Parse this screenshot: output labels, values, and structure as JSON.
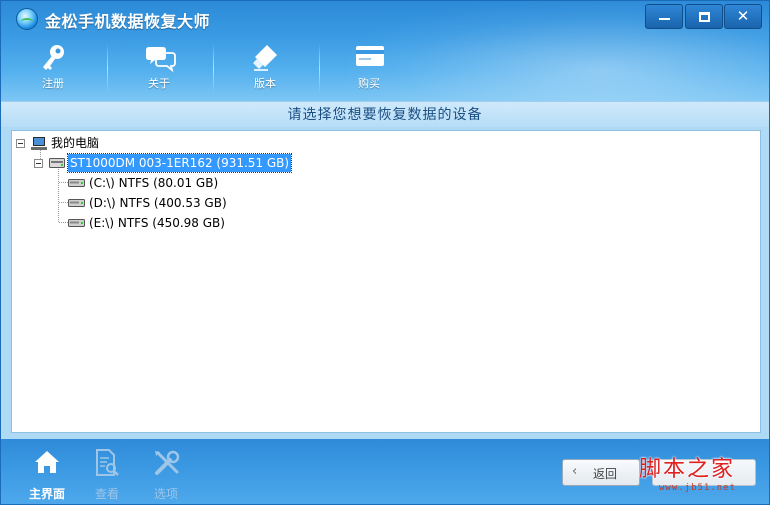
{
  "window": {
    "title": "金松手机数据恢复大师",
    "controls": {
      "minimize": "",
      "maximize": "",
      "close": "✕"
    }
  },
  "toolbar": {
    "items": [
      {
        "label": "注册",
        "icon": "key-icon"
      },
      {
        "label": "关于",
        "icon": "chat-bubbles-icon"
      },
      {
        "label": "版本",
        "icon": "usb-drive-icon"
      },
      {
        "label": "购买",
        "icon": "credit-card-icon"
      }
    ]
  },
  "heading": "请选择您想要恢复数据的设备",
  "tree": {
    "root": {
      "label": "我的电脑",
      "icon": "computer-icon"
    },
    "disk": {
      "label": "ST1000DM 003-1ER162 (931.51 GB)",
      "icon": "hard-disk-icon",
      "selected": true
    },
    "partitions": [
      {
        "label": "(C:\\) NTFS (80.01 GB)",
        "icon": "drive-icon"
      },
      {
        "label": "(D:\\) NTFS (400.53 GB)",
        "icon": "drive-icon"
      },
      {
        "label": "(E:\\) NTFS (450.98 GB)",
        "icon": "drive-icon"
      }
    ]
  },
  "bottom_nav": [
    {
      "label": "主界面",
      "icon": "home-icon",
      "state": "active"
    },
    {
      "label": "查看",
      "icon": "document-search-icon",
      "state": "disabled"
    },
    {
      "label": "选项",
      "icon": "tools-icon",
      "state": "disabled"
    }
  ],
  "back_button": {
    "label": "返回",
    "icon": "chevron-left-icon"
  },
  "watermark": {
    "title": "脚本之家",
    "url": "www.jb51.net"
  },
  "colors": {
    "accent": "#2f8ad8",
    "selection": "#3399ff",
    "heading_text": "#1a4f84"
  }
}
